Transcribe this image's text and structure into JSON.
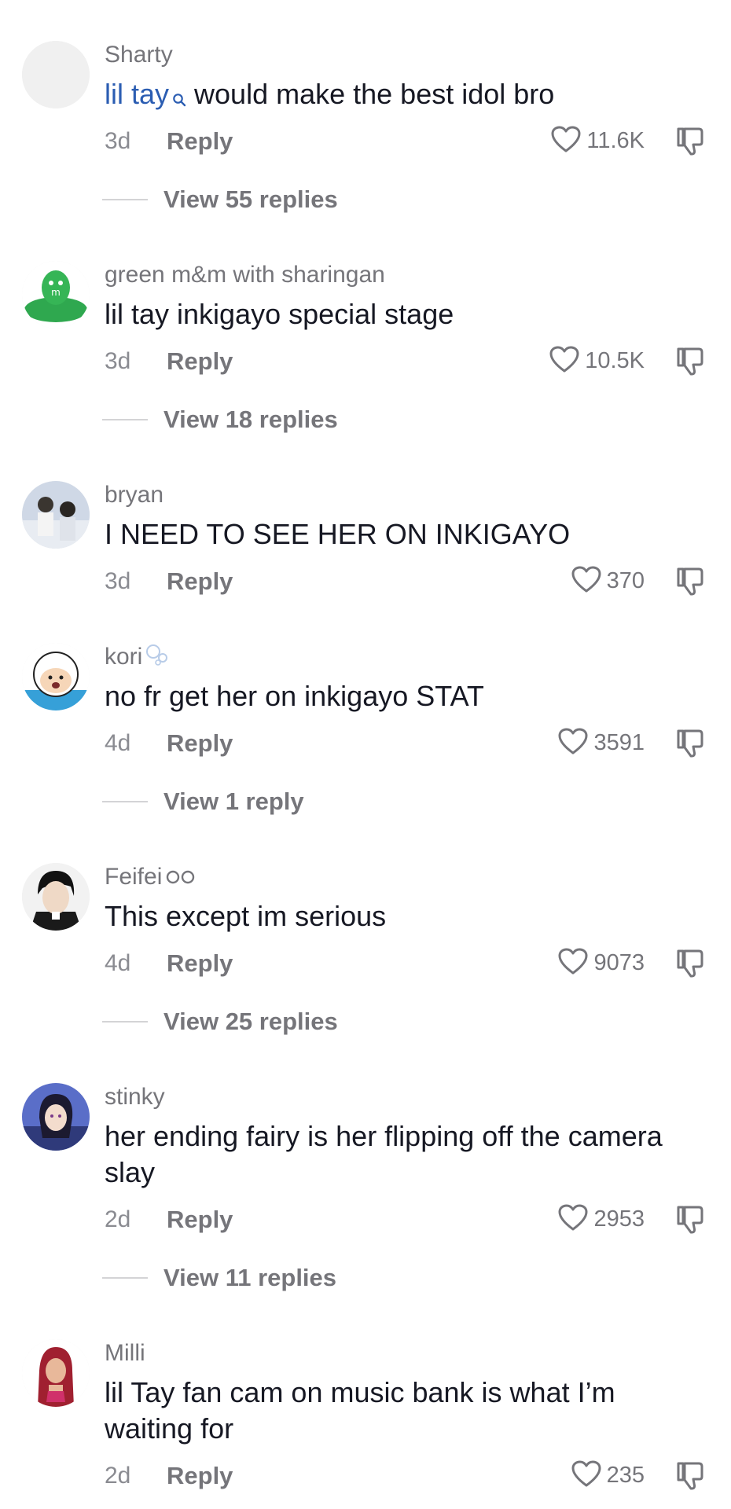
{
  "comments": [
    {
      "username": "Sharty",
      "search_tag": "lil tay",
      "text": " would make the best idol bro",
      "time": "3d",
      "reply_label": "Reply",
      "likes": "11.6K",
      "view_replies": "View 55 replies"
    },
    {
      "username": "green m&m with sharingan",
      "text": "lil tay inkigayo special stage",
      "time": "3d",
      "reply_label": "Reply",
      "likes": "10.5K",
      "view_replies": "View 18 replies"
    },
    {
      "username": "bryan",
      "text": "I NEED TO SEE HER ON INKIGAYO",
      "time": "3d",
      "reply_label": "Reply",
      "likes": "370"
    },
    {
      "username": "kori",
      "text": "no fr get her on inkigayo STAT",
      "time": "4d",
      "reply_label": "Reply",
      "likes": "3591",
      "view_replies": "View 1 reply"
    },
    {
      "username": "Feifei",
      "text": "This except im serious",
      "time": "4d",
      "reply_label": "Reply",
      "likes": "9073",
      "view_replies": "View 25 replies"
    },
    {
      "username": "stinky",
      "text": "her ending fairy is her flipping off the camera slay",
      "time": "2d",
      "reply_label": "Reply",
      "likes": "2953",
      "view_replies": "View 11 replies"
    },
    {
      "username": "Milli",
      "text": "lil Tay fan cam on music bank is what I’m waiting for",
      "time": "2d",
      "reply_label": "Reply",
      "likes": "235"
    }
  ],
  "icons": {
    "like": "heart-outline-icon",
    "dislike": "thumbs-down-icon",
    "search_tag": "search-icon"
  },
  "colors": {
    "username": "#75757a",
    "text": "#161823",
    "search_tag": "#2b5db2",
    "meta": "#8a8b91"
  }
}
